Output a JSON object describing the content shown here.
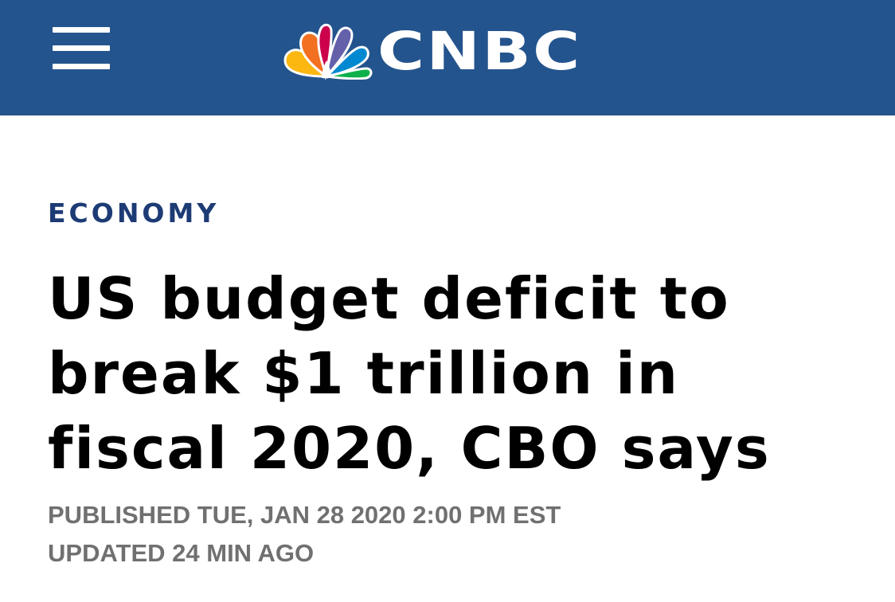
{
  "header": {
    "menu_icon": "hamburger-menu-icon",
    "logo_icon": "nbc-peacock-icon",
    "brand_name": "CNBC",
    "background_color": "#24548d"
  },
  "article": {
    "section": "ECONOMY",
    "headline_lines": [
      "US budget deficit to",
      "break $1 trillion in",
      "fiscal 2020, CBO says"
    ],
    "published": "PUBLISHED TUE, JAN 28 2020 2:00 PM EST",
    "updated": "UPDATED 24 MIN AGO",
    "section_color": "#1d3b74",
    "meta_color": "#707070"
  }
}
